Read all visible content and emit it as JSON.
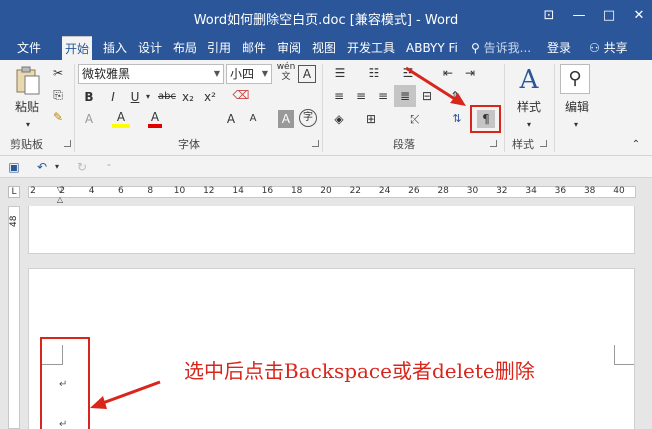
{
  "title_bar": {
    "title": "Word如何删除空白页.doc [兼容模式] - Word",
    "controls": [
      "⊡",
      "—",
      "□",
      "✕"
    ]
  },
  "tabs": [
    "文件",
    "开始",
    "插入",
    "设计",
    "布局",
    "引用",
    "邮件",
    "审阅",
    "视图",
    "开发工具",
    "ABBYY Fi"
  ],
  "tell_me": "告诉我...",
  "login": "登录",
  "share": "共享",
  "ribbon": {
    "clipboard": {
      "paste": "粘贴",
      "group": "剪贴板"
    },
    "font": {
      "name": "微软雅黑",
      "size": "小四",
      "wen": "wén",
      "A": "A",
      "buttons": [
        "B",
        "I",
        "U",
        "abc",
        "x₂",
        "x²"
      ],
      "row3": [
        "A",
        "A",
        "A",
        "A",
        "A",
        "Ａ",
        "字"
      ],
      "group": "字体"
    },
    "paragraph": {
      "group": "段落"
    },
    "styles": {
      "label": "样式",
      "group": "样式"
    },
    "editing": {
      "label": "编辑"
    }
  },
  "ruler": {
    "ticks": [
      "2",
      "2",
      "4",
      "6",
      "8",
      "10",
      "12",
      "14",
      "16",
      "18",
      "20",
      "22",
      "24",
      "26",
      "28",
      "30",
      "32",
      "34",
      "36",
      "38",
      "40"
    ],
    "vertical_label": "48"
  },
  "annotation": "选中后点击Backspace或者delete删除",
  "paragraph_mark": "↵",
  "colors": {
    "brand": "#2b579a",
    "ribbon_bg": "#f3f3f3",
    "annotation_red": "#d9261c"
  }
}
